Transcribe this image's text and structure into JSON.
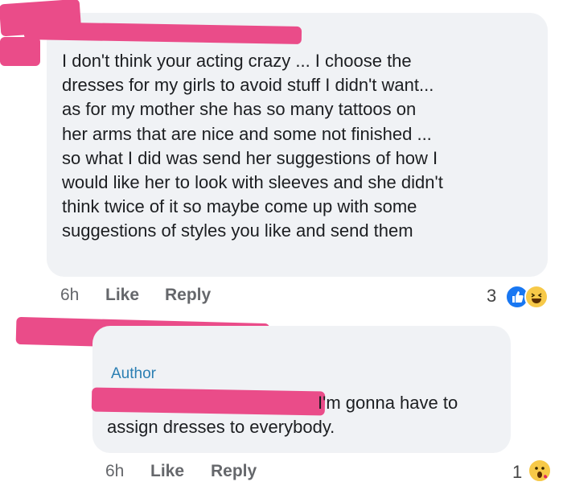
{
  "comments": [
    {
      "text": "I don't think your acting crazy ... I choose the\ndresses for my girls to avoid stuff I didn't want...\nas for my mother she has so many tattoos on\nher arms that are nice and some not finished ...\nso what I did was send her suggestions of how I\nwould like her to look with sleeves and she didn't\nthink twice of it so maybe come up with some\nsuggestions of styles you like and send them",
      "time": "6h",
      "like_label": "Like",
      "reply_label": "Reply",
      "reaction_count": "3",
      "reactions": [
        "like-icon",
        "haha-icon"
      ]
    },
    {
      "badge": "Author",
      "text": "I'm gonna have to\nassign dresses to everybody.",
      "time": "6h",
      "like_label": "Like",
      "reply_label": "Reply",
      "reaction_count": "1",
      "reactions": [
        "wow-icon"
      ]
    }
  ],
  "colors": {
    "bubble": "#f0f2f5",
    "meta_text": "#65676b",
    "author_badge": "#2b7fb3",
    "redaction": "#ea4c89"
  }
}
